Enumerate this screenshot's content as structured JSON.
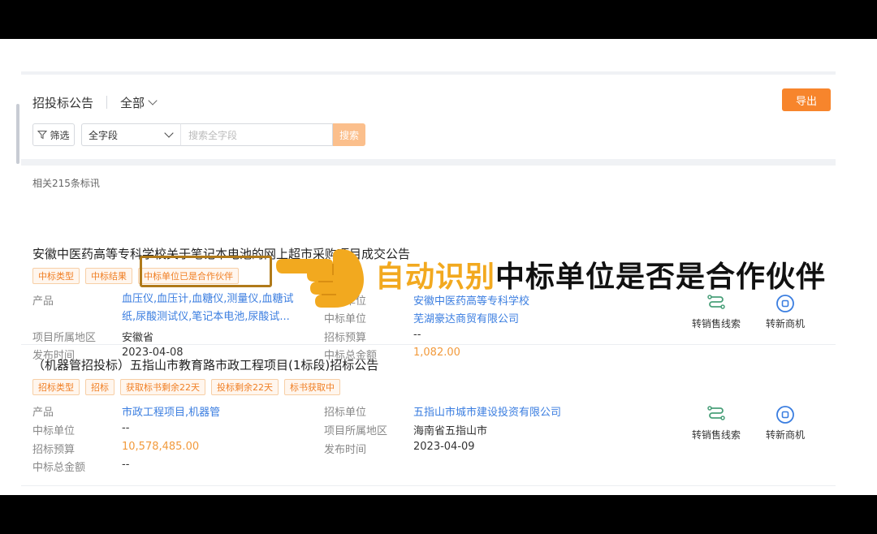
{
  "header": {
    "title": "招投标公告",
    "scope": "全部",
    "export_label": "导出"
  },
  "filter_bar": {
    "filter_label": "筛选",
    "field_value": "全字段",
    "search_placeholder": "搜索全字段",
    "search_label": "搜索"
  },
  "result_count": "相关215条标讯",
  "items": [
    {
      "title": "安徽中医药高等专科学校关于笔记本电池的网上超市采购项目成交公告",
      "tags": [
        "中标类型",
        "中标结果",
        "中标单位已是合作伙伴"
      ],
      "product_label": "产品",
      "product_line1": "血压仪,血压计,血糖仪,测量仪,血糖试",
      "product_line2": "纸,尿酸测试仪,笔记本电池,尿酸试...",
      "region_label": "项目所属地区",
      "region_value": "安徽省",
      "publish_label": "发布时间",
      "publish_value": "2023-04-08",
      "tenderer_label": "招标单位",
      "tenderer_value": "安徽中医药高等专科学校",
      "winner_label": "中标单位",
      "winner_value": "芜湖豪达商贸有限公司",
      "budget_label": "招标预算",
      "budget_value": "--",
      "amount_label": "中标总金额",
      "amount_value": "1,082.00",
      "action1": "转销售线索",
      "action2": "转新商机"
    },
    {
      "title": "（机器管招投标）五指山市教育路市政工程项目(1标段)招标公告",
      "tags": [
        "招标类型",
        "招标",
        "获取标书剩余22天",
        "投标剩余22天",
        "标书获取中"
      ],
      "product_label": "产品",
      "product_value": "市政工程项目,机器管",
      "winner_label": "中标单位",
      "winner_value": "--",
      "budget_label": "招标预算",
      "budget_value": "10,578,485.00",
      "amount_label": "中标总金额",
      "amount_value": "--",
      "tenderer_label": "招标单位",
      "tenderer_value": "五指山市城市建设投资有限公司",
      "region_label": "项目所属地区",
      "region_value": "海南省五指山市",
      "publish_label": "发布时间",
      "publish_value": "2023-04-09",
      "action1": "转销售线索",
      "action2": "转新商机"
    }
  ],
  "overlay": {
    "caption_highlight": "自动识别",
    "caption_rest": "中标单位是否是合作伙伴"
  },
  "colors": {
    "accent": "#f7852c",
    "link": "#3b7ee0",
    "amount": "#f29a3c",
    "caption_highlight": "#f2a91f"
  }
}
